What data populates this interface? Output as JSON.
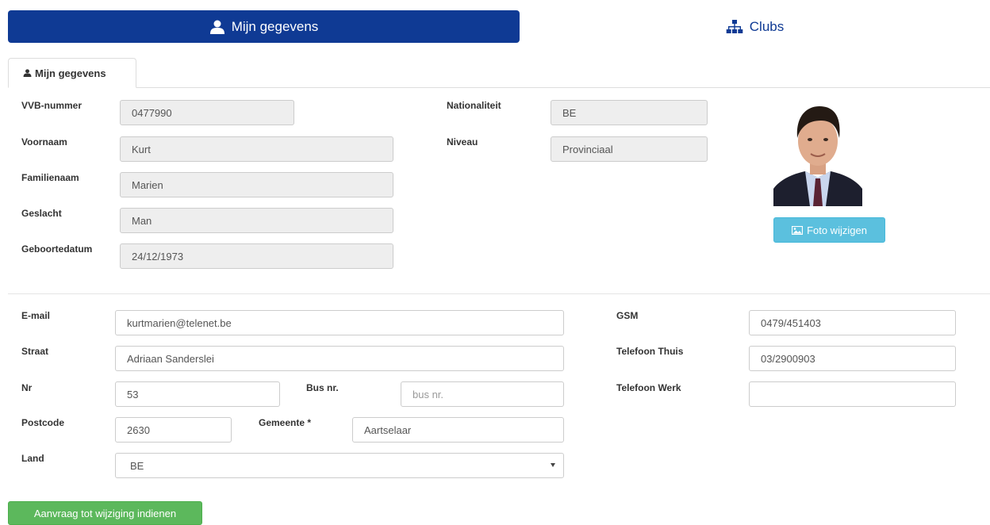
{
  "nav": {
    "profile_label": "Mijn gegevens",
    "clubs_label": "Clubs"
  },
  "tab": {
    "label": "Mijn gegevens"
  },
  "personal": {
    "vvb_label": "VVB-nummer",
    "vvb_value": "0477990",
    "firstname_label": "Voornaam",
    "firstname_value": "Kurt",
    "lastname_label": "Familienaam",
    "lastname_value": "Marien",
    "gender_label": "Geslacht",
    "gender_value": "Man",
    "birthdate_label": "Geboortedatum",
    "birthdate_value": "24/12/1973",
    "nationality_label": "Nationaliteit",
    "nationality_value": "BE",
    "level_label": "Niveau",
    "level_value": "Provinciaal"
  },
  "photo": {
    "change_label": "Foto wijzigen"
  },
  "contact": {
    "email_label": "E-mail",
    "email_value": "kurtmarien@telenet.be",
    "street_label": "Straat",
    "street_value": "Adriaan Sanderslei",
    "nr_label": "Nr",
    "nr_value": "53",
    "bus_label": "Bus nr.",
    "bus_value": "",
    "bus_placeholder": "bus nr.",
    "postcode_label": "Postcode",
    "postcode_value": "2630",
    "city_label": "Gemeente *",
    "city_value": "Aartselaar",
    "country_label": "Land",
    "country_value": "BE",
    "gsm_label": "GSM",
    "gsm_value": "0479/451403",
    "home_phone_label": "Telefoon Thuis",
    "home_phone_value": "03/2900903",
    "work_phone_label": "Telefoon Werk",
    "work_phone_value": ""
  },
  "actions": {
    "submit_label": "Aanvraag tot wijziging indienen"
  },
  "colors": {
    "nav_active": "#0f3a94",
    "info_button": "#5bc0de",
    "success_button": "#5cb85c",
    "readonly_bg": "#eeeeee"
  },
  "icons": {
    "profile": "user-icon",
    "clubs": "sitemap-icon",
    "photo": "image-icon"
  }
}
